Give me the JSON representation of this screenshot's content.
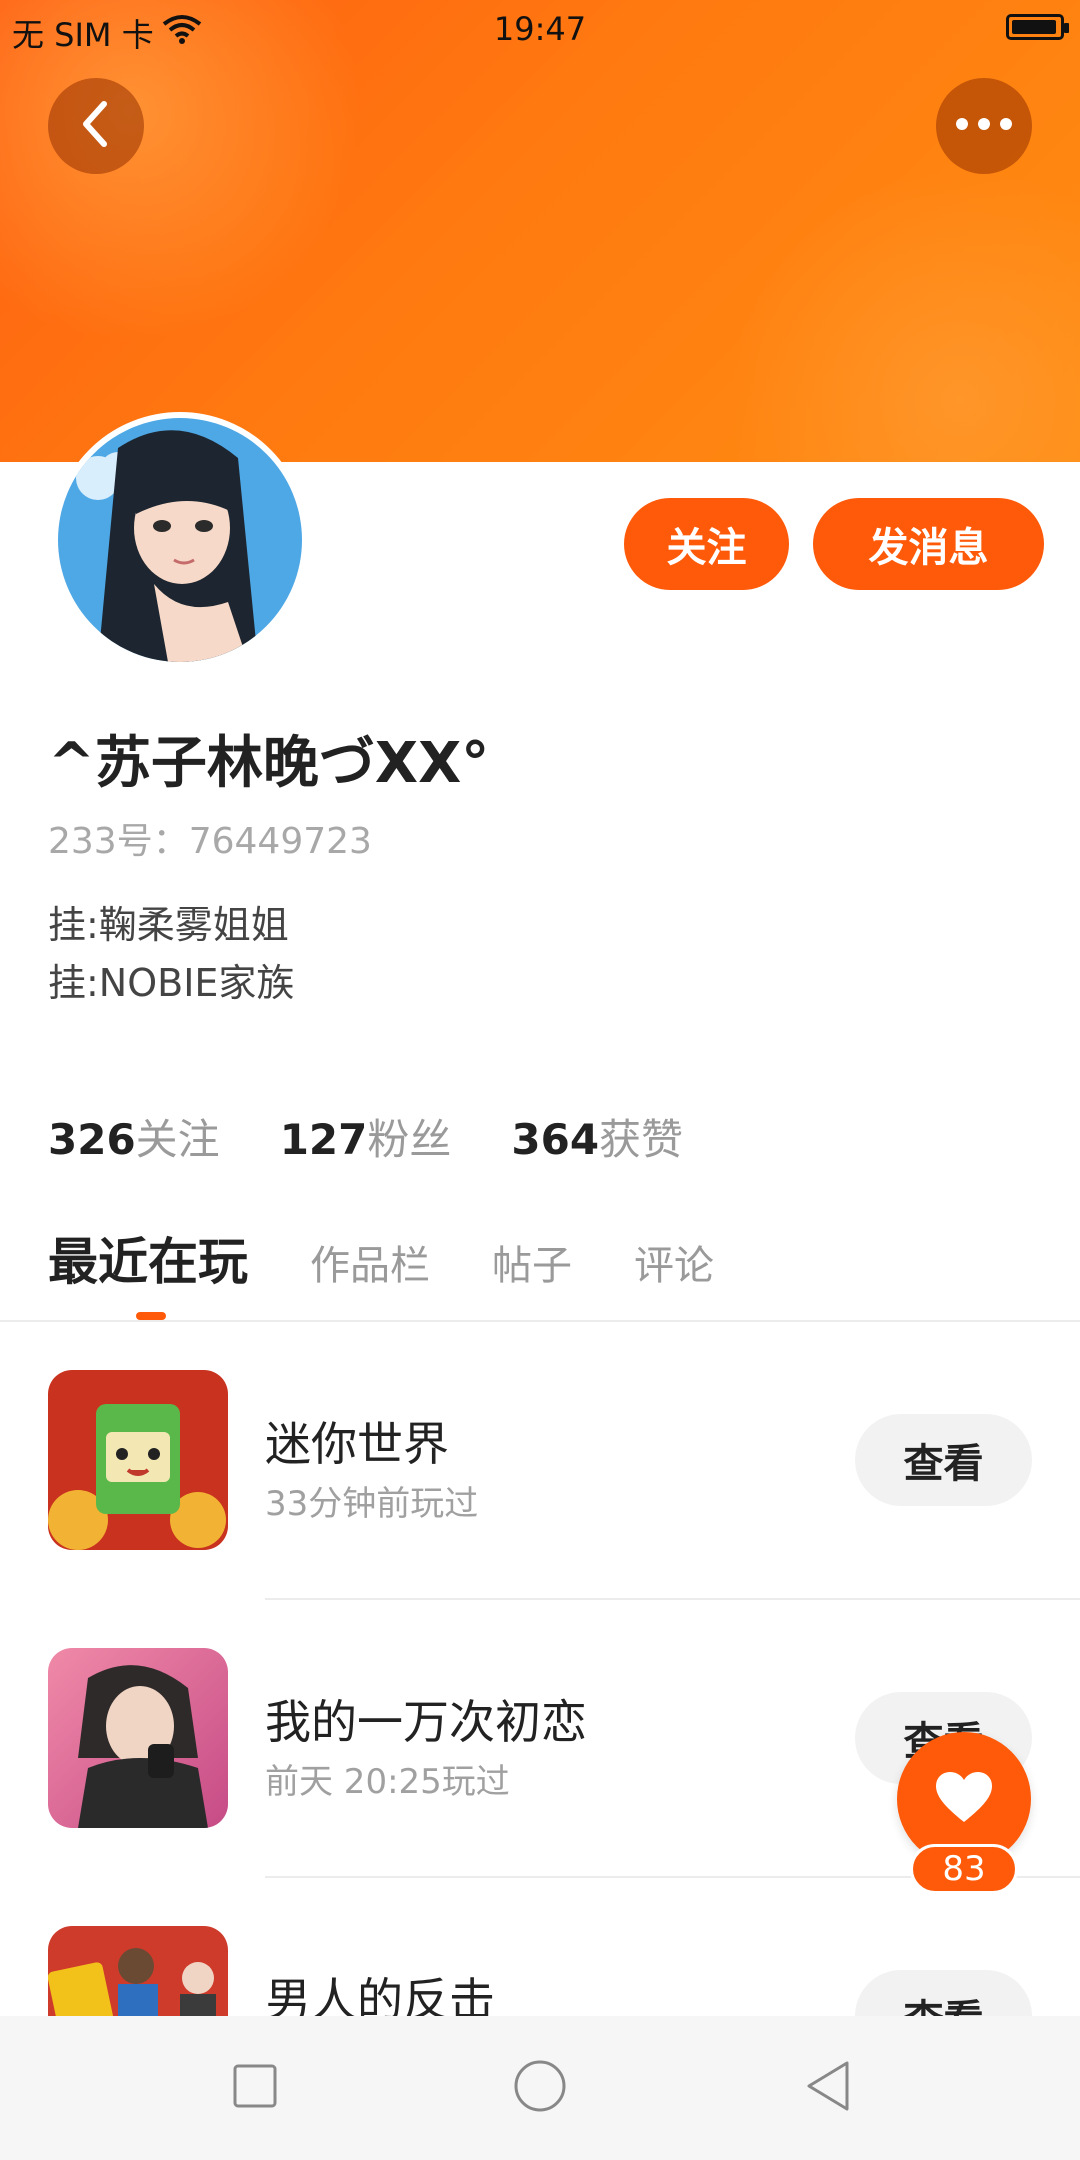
{
  "status_bar": {
    "carrier": "无 SIM 卡",
    "time": "19:47",
    "battery_level": 0.95
  },
  "profile": {
    "nickname": "^苏子林晚づXX°",
    "uid": "233号：76449723",
    "bio_lines": [
      "挂:鞠柔雾姐姐",
      "挂:NOBIE家族"
    ],
    "follow_label": "关注",
    "message_label": "发消息"
  },
  "stats": [
    {
      "value": "326",
      "label": "关注"
    },
    {
      "value": "127",
      "label": "粉丝"
    },
    {
      "value": "364",
      "label": "获赞"
    }
  ],
  "tabs": [
    "最近在玩",
    "作品栏",
    "帖子",
    "评论"
  ],
  "games": [
    {
      "name": "迷你世界",
      "played": "33分钟前玩过",
      "button": "查看"
    },
    {
      "name": "我的一万次初恋",
      "played": "前天 20:25玩过",
      "button": "查看"
    },
    {
      "name": "男人的反击",
      "played": "",
      "button": "查看"
    }
  ],
  "like": {
    "count": "83"
  },
  "colors": {
    "accent": "#ff5a0a",
    "banner": "#ff7a10"
  }
}
